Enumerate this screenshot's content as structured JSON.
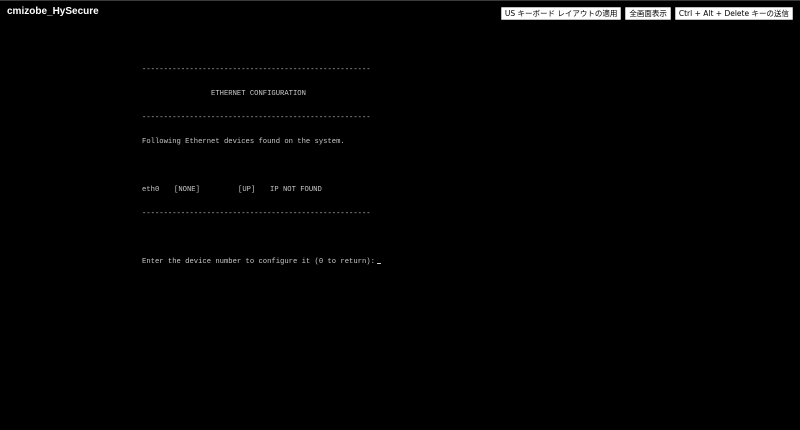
{
  "vm": {
    "name": "cmizobe_HySecure"
  },
  "toolbar": {
    "us_keyboard_label": "US キーボード レイアウトの適用",
    "fullscreen_label": "全画面表示",
    "ctrl_alt_del_label": "Ctrl + Alt + Delete キーの送信"
  },
  "console": {
    "separator": "-----------------------------------------------------",
    "title": "                ETHERNET CONFIGURATION",
    "found_text": "Following Ethernet devices found on the system.",
    "devices": [
      {
        "name": "eth0",
        "type": "[NONE]",
        "state": "[UP]",
        "ip": "IP NOT FOUND"
      }
    ],
    "prompt": "Enter the device number to configure it (0 to return):"
  }
}
